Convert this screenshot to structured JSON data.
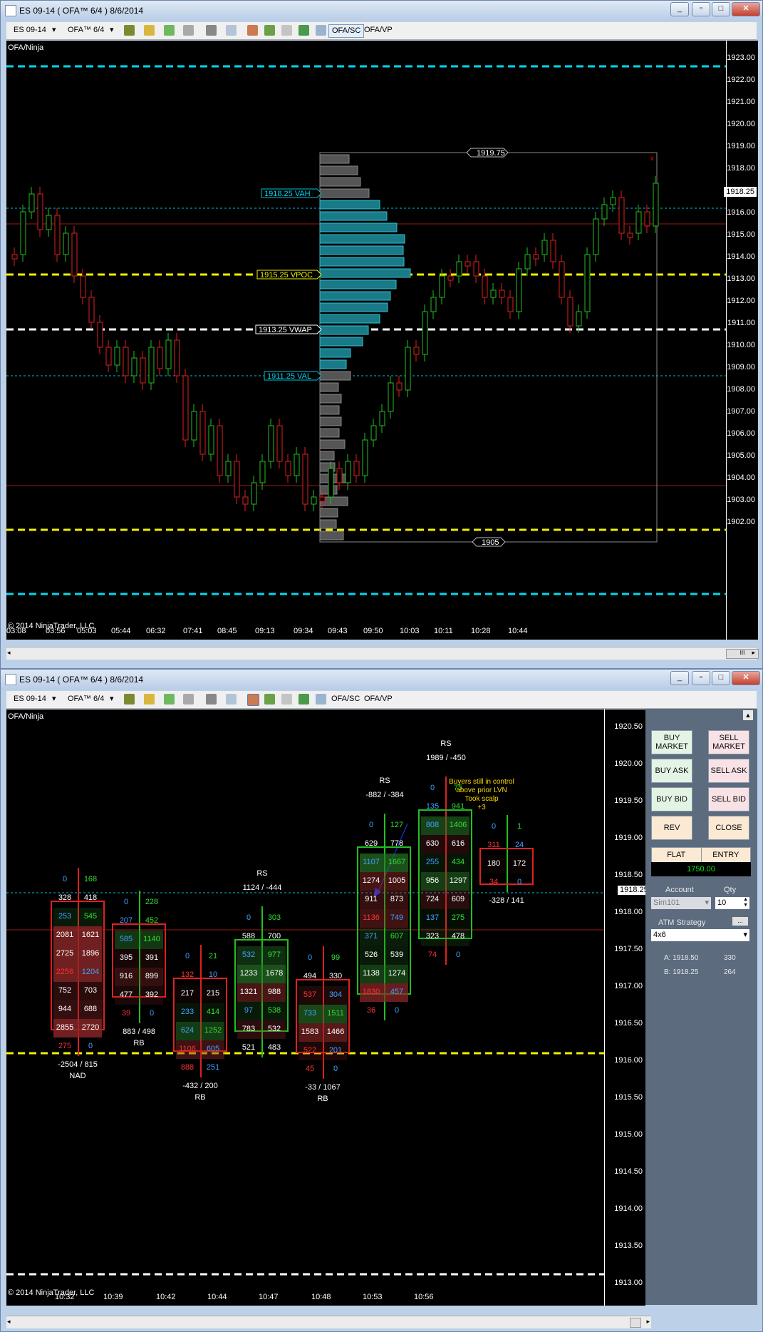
{
  "window1": {
    "title": "ES 09-14 ( OFA™ 6/4 )  8/6/2014",
    "toolbar": {
      "instrument": "ES 09-14",
      "interval": "OFA™ 6/4",
      "tab1": "OFA/SC",
      "tab2": "OFA/VP"
    },
    "chart_label": "OFA/Ninja",
    "copyright": "© 2014 NinjaTrader, LLC",
    "price_labels": [
      "1923.00",
      "1922.00",
      "1921.00",
      "1920.00",
      "1919.00",
      "1918.00",
      "1917.00",
      "1916.00",
      "1915.00",
      "1914.00",
      "1913.00",
      "1912.00",
      "1911.00",
      "1910.00",
      "1909.00",
      "1908.00",
      "1907.00",
      "1906.00",
      "1905.00",
      "1904.00",
      "1903.00",
      "1902.00"
    ],
    "current_price": "1918.25",
    "time_labels": [
      "03:08",
      "03:56",
      "05:03",
      "05:44",
      "06:32",
      "07:41",
      "08:45",
      "09:13",
      "09:34",
      "09:43",
      "09:50",
      "10:03",
      "10:11",
      "10:28",
      "10:44"
    ],
    "annotations": {
      "high": "1919.75",
      "low": "1905",
      "vah": "1918.25 VAH",
      "vpoc": "1915.25 VPOC",
      "vwap": "1913.25 VWAP",
      "val": "1911.25 VAL",
      "close_marker": "x"
    },
    "scroll_label": "III"
  },
  "window2": {
    "title": "ES 09-14 ( OFA™ 6/4 )  8/6/2014",
    "toolbar": {
      "instrument": "ES 09-14",
      "interval": "OFA™ 6/4",
      "tab1": "OFA/SC",
      "tab2": "OFA/VP"
    },
    "chart_label": "OFA/Ninja",
    "copyright": "© 2014 NinjaTrader, LLC",
    "price_labels": [
      "1920.50",
      "1920.00",
      "1919.50",
      "1919.00",
      "1918.50",
      "1918.00",
      "1917.50",
      "1917.00",
      "1916.50",
      "1916.00",
      "1915.50",
      "1915.00",
      "1914.50",
      "1914.00",
      "1913.50",
      "1913.00"
    ],
    "current_price": "1918.25",
    "time_labels": [
      "10:32",
      "10:39",
      "10:42",
      "10:44",
      "10:47",
      "10:48",
      "10:53",
      "10:56"
    ],
    "annotation": [
      "Buyers still in control",
      "above prior LVN",
      "Took scalp",
      "+3"
    ],
    "panel": {
      "buy_market": "BUY MARKET",
      "sell_market": "SELL MARKET",
      "buy_ask": "BUY ASK",
      "sell_ask": "SELL ASK",
      "buy_bid": "BUY BID",
      "sell_bid": "SELL BID",
      "rev": "REV",
      "close": "CLOSE",
      "flat": "FLAT",
      "entry": "ENTRY",
      "pnl": "1750.00",
      "account_label": "Account",
      "qty_label": "Qty",
      "account": "Sim101",
      "qty": "10",
      "atm_label": "ATM Strategy",
      "atm_value": "4x6",
      "ask": "A: 1918.50",
      "ask_size": "330",
      "bid": "B: 1918.25",
      "bid_size": "264"
    },
    "bars": [
      {
        "time": "10:32",
        "top_label": "",
        "delta": "-2504 / 815",
        "bottom_label": "NAD",
        "rows": [
          [
            "0",
            "168"
          ],
          [
            "328",
            "418"
          ],
          [
            "253",
            "545"
          ],
          [
            "2081",
            "1621"
          ],
          [
            "2725",
            "1896"
          ],
          [
            "2256",
            "1204"
          ],
          [
            "752",
            "703"
          ],
          [
            "944",
            "688"
          ],
          [
            "2855",
            "2720"
          ],
          [
            "275",
            "0"
          ]
        ]
      },
      {
        "time": "10:39",
        "top_label": "",
        "delta": "883 / 498",
        "bottom_label": "RB",
        "rows": [
          [
            "0",
            "228"
          ],
          [
            "207",
            "452"
          ],
          [
            "585",
            "1140"
          ],
          [
            "395",
            "391"
          ],
          [
            "916",
            "899"
          ],
          [
            "477",
            "392"
          ],
          [
            "39",
            "0"
          ]
        ]
      },
      {
        "time": "10:42",
        "top_label": "",
        "delta": "-432 / 200",
        "bottom_label": "RB",
        "rows": [
          [
            "0",
            "21"
          ],
          [
            "132",
            "10"
          ],
          [
            "217",
            "215"
          ],
          [
            "233",
            "414"
          ],
          [
            "624",
            "1252"
          ],
          [
            "1106",
            "605"
          ],
          [
            "888",
            "251"
          ]
        ]
      },
      {
        "time": "10:44",
        "top_label": "RS",
        "delta": "1124 / -444",
        "bottom_label": "",
        "rows": [
          [
            "0",
            "303"
          ],
          [
            "588",
            "700"
          ],
          [
            "532",
            "977"
          ],
          [
            "1233",
            "1678"
          ],
          [
            "1321",
            "988"
          ],
          [
            "97",
            "538"
          ],
          [
            "783",
            "532"
          ],
          [
            "521",
            "483"
          ]
        ]
      },
      {
        "time": "10:47",
        "top_label": "",
        "delta": "-33 / 1067",
        "bottom_label": "RB",
        "rows": [
          [
            "0",
            "99"
          ],
          [
            "494",
            "330"
          ],
          [
            "537",
            "304"
          ],
          [
            "733",
            "1511"
          ],
          [
            "1583",
            "1466"
          ],
          [
            "522",
            "201"
          ],
          [
            "45",
            "0"
          ]
        ]
      },
      {
        "time": "10:48",
        "top_label": "RS",
        "delta": "-882 / -384",
        "bottom_label": "",
        "rows": [
          [
            "0",
            "127"
          ],
          [
            "629",
            "778"
          ],
          [
            "1107",
            "1667"
          ],
          [
            "1274",
            "1005"
          ],
          [
            "911",
            "873"
          ],
          [
            "1136",
            "749"
          ],
          [
            "371",
            "607"
          ],
          [
            "526",
            "539"
          ],
          [
            "1138",
            "1274"
          ],
          [
            "1830",
            "457"
          ],
          [
            "36",
            "0"
          ]
        ]
      },
      {
        "time": "10:53",
        "top_label": "RS",
        "delta": "1989 / -450",
        "bottom_label": "",
        "rows": [
          [
            "0",
            "75"
          ],
          [
            "135",
            "941"
          ],
          [
            "808",
            "1406"
          ],
          [
            "630",
            "616"
          ],
          [
            "255",
            "434"
          ],
          [
            "956",
            "1297"
          ],
          [
            "724",
            "609"
          ],
          [
            "137",
            "275"
          ],
          [
            "323",
            "478"
          ],
          [
            "74",
            "0"
          ]
        ]
      },
      {
        "time": "10:56",
        "top_label": "",
        "delta": "-328 / 141",
        "bottom_label": "",
        "rows": [
          [
            "0",
            "1"
          ],
          [
            "311",
            "24"
          ],
          [
            "180",
            "172"
          ],
          [
            "34",
            "0"
          ]
        ]
      }
    ]
  }
}
